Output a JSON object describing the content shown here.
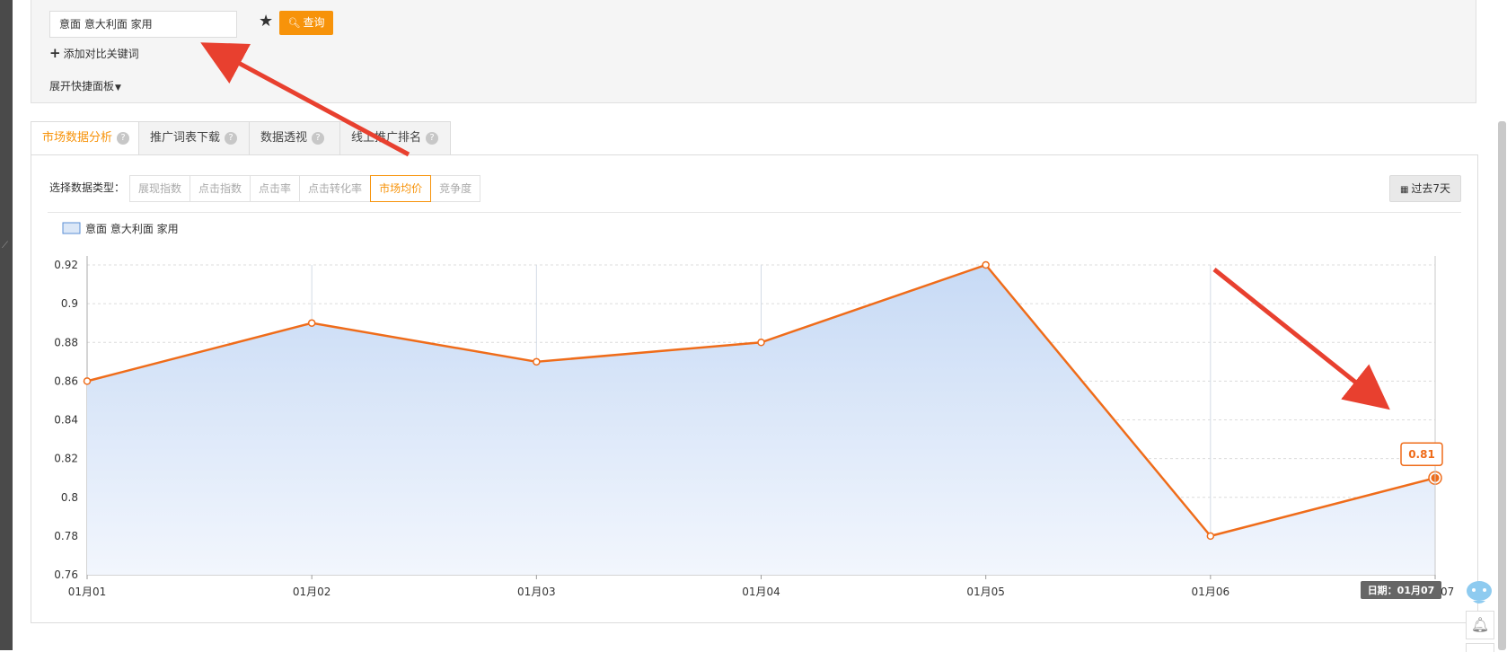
{
  "search": {
    "keyword": "意面 意大利面 家用",
    "query_label": "查询",
    "add_compare_label": "添加对比关键词",
    "expand_panel_label": "展开快捷面板"
  },
  "tabs": [
    {
      "label": "市场数据分析",
      "active": true
    },
    {
      "label": "推广词表下载",
      "active": false
    },
    {
      "label": "数据透视",
      "active": false
    },
    {
      "label": "线上推广排名",
      "active": false
    }
  ],
  "data_type": {
    "label": "选择数据类型：",
    "options": [
      {
        "label": "展现指数",
        "active": false
      },
      {
        "label": "点击指数",
        "active": false
      },
      {
        "label": "点击率",
        "active": false
      },
      {
        "label": "点击转化率",
        "active": false
      },
      {
        "label": "市场均价",
        "active": true
      },
      {
        "label": "竞争度",
        "active": false
      }
    ]
  },
  "date_range": {
    "label": "过去7天"
  },
  "colors": {
    "accent": "#f7930a",
    "line": "#ef6c1a",
    "area_top": "#c7daf5",
    "area_bottom": "#f2f6fd",
    "arrow": "#e8402f"
  },
  "icons": {
    "star": "star-icon",
    "search": "search-icon",
    "plus": "plus-icon",
    "caret": "caret-down-icon",
    "help": "help-icon",
    "calendar": "calendar-icon",
    "assistant": "assistant-icon",
    "bell": "bell-icon"
  },
  "chart_data": {
    "type": "area",
    "series": [
      {
        "name": "意面 意大利面 家用",
        "values": [
          0.86,
          0.89,
          0.87,
          0.88,
          0.92,
          0.78,
          0.81
        ]
      }
    ],
    "categories": [
      "01月01",
      "01月02",
      "01月03",
      "01月04",
      "01月05",
      "01月06",
      "01月07"
    ],
    "yticks": [
      "0.76",
      "0.78",
      "0.8",
      "0.82",
      "0.84",
      "0.86",
      "0.88",
      "0.9",
      "0.92"
    ],
    "ylim": [
      0.76,
      0.92
    ],
    "grid": true,
    "legend": "top-left",
    "tooltip": {
      "value_label": "0.81",
      "date_label": "日期：01月07",
      "index": 6
    }
  }
}
